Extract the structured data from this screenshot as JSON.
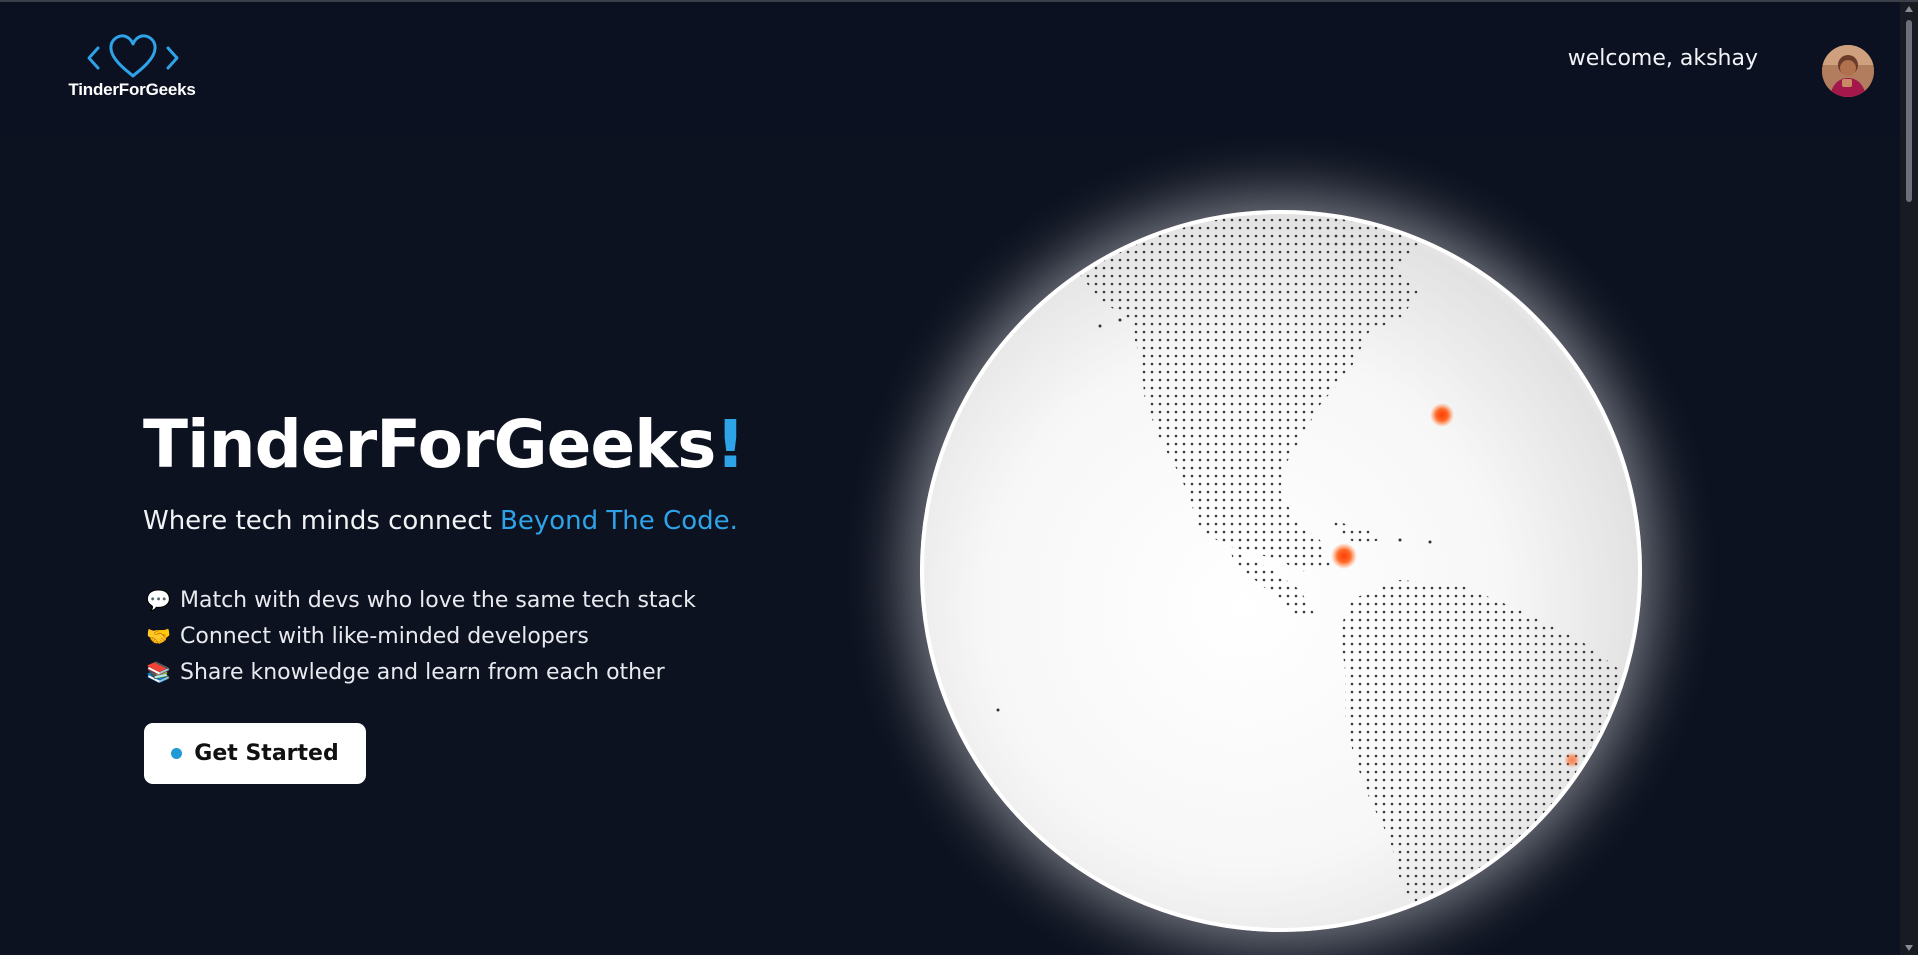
{
  "navbar": {
    "brand": "TinderForGeeks",
    "welcome_text": "welcome, akshay",
    "logo_icon": "code-heart-icon",
    "avatar_alt": "akshay"
  },
  "hero": {
    "title": "TinderForGeeks",
    "title_mark": "!",
    "subtitle_prefix": "Where tech minds connect ",
    "subtitle_highlight": "Beyond The Code.",
    "features": [
      {
        "icon": "💬",
        "icon_name": "speech-bubble-icon",
        "text": "Match with devs who love the same tech stack"
      },
      {
        "icon": "🤝",
        "icon_name": "handshake-icon",
        "text": "Connect with like-minded developers"
      },
      {
        "icon": "📚",
        "icon_name": "books-icon",
        "text": "Share knowledge and learn from each other"
      }
    ],
    "cta_label": "Get Started"
  },
  "colors": {
    "background": "#0d1220",
    "navbar": "#0b1120",
    "accent": "#2ea3e8",
    "cta_dot": "#1f9ad6",
    "globe_marker": "#ff5a1f"
  }
}
